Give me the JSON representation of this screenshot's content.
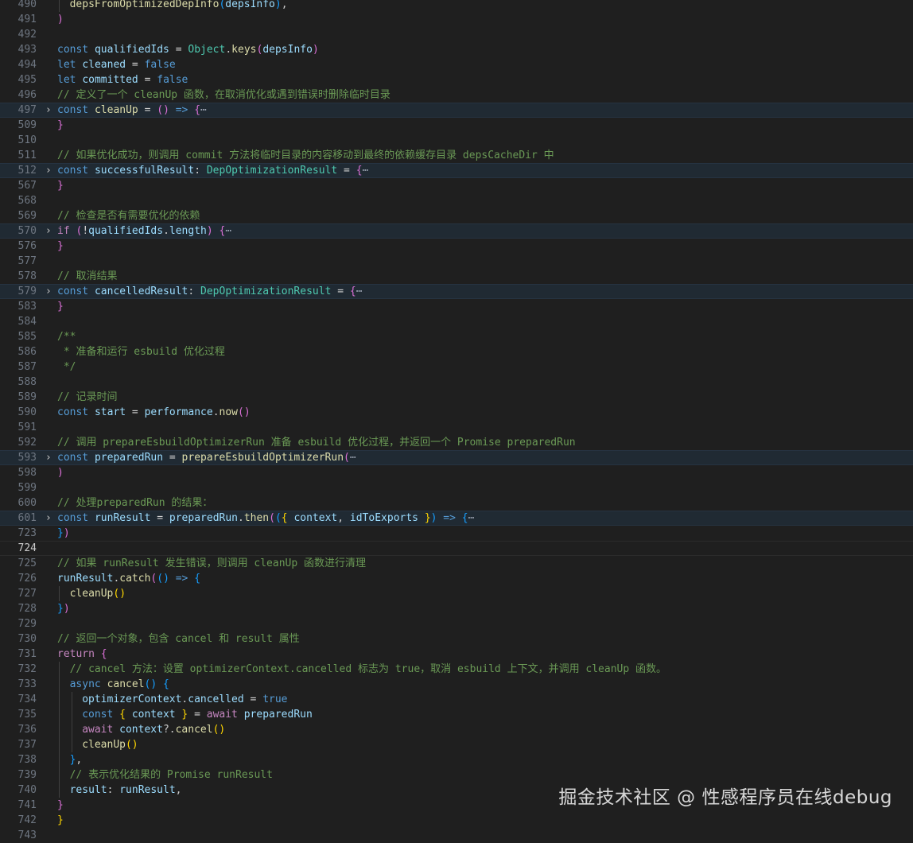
{
  "editor": {
    "lines": [
      {
        "n": "490",
        "indent": 2,
        "tokens": [
          [
            "depsFromOptimizedDepInfo",
            "fn"
          ],
          [
            "(",
            "b3"
          ],
          [
            "depsInfo",
            "var"
          ],
          [
            ")",
            "b3"
          ],
          [
            ",",
            "pun"
          ]
        ]
      },
      {
        "n": "491",
        "indent": 1,
        "tokens": [
          [
            ")",
            "b2"
          ]
        ]
      },
      {
        "n": "492",
        "indent": 0,
        "tokens": []
      },
      {
        "n": "493",
        "indent": 1,
        "tokens": [
          [
            "const ",
            "kw"
          ],
          [
            "qualifiedIds",
            "var"
          ],
          [
            " = ",
            "op"
          ],
          [
            "Object",
            "type"
          ],
          [
            ".",
            "pun"
          ],
          [
            "keys",
            "fn"
          ],
          [
            "(",
            "b2"
          ],
          [
            "depsInfo",
            "var"
          ],
          [
            ")",
            "b2"
          ]
        ]
      },
      {
        "n": "494",
        "indent": 1,
        "tokens": [
          [
            "let ",
            "kw"
          ],
          [
            "cleaned",
            "var"
          ],
          [
            " = ",
            "op"
          ],
          [
            "false",
            "kw"
          ]
        ]
      },
      {
        "n": "495",
        "indent": 1,
        "tokens": [
          [
            "let ",
            "kw"
          ],
          [
            "committed",
            "var"
          ],
          [
            " = ",
            "op"
          ],
          [
            "false",
            "kw"
          ]
        ]
      },
      {
        "n": "496",
        "indent": 1,
        "tokens": [
          [
            "// 定义了一个 cleanUp 函数，在取消优化或遇到错误时删除临时目录",
            "cm"
          ]
        ]
      },
      {
        "n": "497",
        "indent": 1,
        "fold": true,
        "tokens": [
          [
            "const ",
            "kw"
          ],
          [
            "cleanUp",
            "fn"
          ],
          [
            " = ",
            "op"
          ],
          [
            "()",
            "b2"
          ],
          [
            " => ",
            "kw"
          ],
          [
            "{",
            "b2"
          ],
          [
            "⋯",
            "dim"
          ]
        ]
      },
      {
        "n": "509",
        "indent": 1,
        "tokens": [
          [
            "}",
            "b2"
          ]
        ]
      },
      {
        "n": "510",
        "indent": 0,
        "tokens": []
      },
      {
        "n": "511",
        "indent": 1,
        "tokens": [
          [
            "// 如果优化成功，则调用 commit 方法将临时目录的内容移动到最终的依赖缓存目录 depsCacheDir 中",
            "cm"
          ]
        ]
      },
      {
        "n": "512",
        "indent": 1,
        "fold": true,
        "tokens": [
          [
            "const ",
            "kw"
          ],
          [
            "successfulResult",
            "var"
          ],
          [
            ": ",
            "pun"
          ],
          [
            "DepOptimizationResult",
            "type"
          ],
          [
            " = ",
            "op"
          ],
          [
            "{",
            "b2"
          ],
          [
            "⋯",
            "dim"
          ]
        ]
      },
      {
        "n": "567",
        "indent": 1,
        "tokens": [
          [
            "}",
            "b2"
          ]
        ]
      },
      {
        "n": "568",
        "indent": 0,
        "tokens": []
      },
      {
        "n": "569",
        "indent": 1,
        "tokens": [
          [
            "// 检查是否有需要优化的依赖",
            "cm"
          ]
        ]
      },
      {
        "n": "570",
        "indent": 1,
        "fold": true,
        "tokens": [
          [
            "if ",
            "ctl"
          ],
          [
            "(",
            "b2"
          ],
          [
            "!",
            "op"
          ],
          [
            "qualifiedIds",
            "var"
          ],
          [
            ".",
            "pun"
          ],
          [
            "length",
            "var"
          ],
          [
            ")",
            "b2"
          ],
          [
            " ",
            "pun"
          ],
          [
            "{",
            "b2"
          ],
          [
            "⋯",
            "dim"
          ]
        ]
      },
      {
        "n": "576",
        "indent": 1,
        "tokens": [
          [
            "}",
            "b2"
          ]
        ]
      },
      {
        "n": "577",
        "indent": 0,
        "tokens": []
      },
      {
        "n": "578",
        "indent": 1,
        "tokens": [
          [
            "// 取消结果",
            "cm"
          ]
        ]
      },
      {
        "n": "579",
        "indent": 1,
        "fold": true,
        "tokens": [
          [
            "const ",
            "kw"
          ],
          [
            "cancelledResult",
            "var"
          ],
          [
            ": ",
            "pun"
          ],
          [
            "DepOptimizationResult",
            "type"
          ],
          [
            " = ",
            "op"
          ],
          [
            "{",
            "b2"
          ],
          [
            "⋯",
            "dim"
          ]
        ]
      },
      {
        "n": "583",
        "indent": 1,
        "tokens": [
          [
            "}",
            "b2"
          ]
        ]
      },
      {
        "n": "584",
        "indent": 0,
        "tokens": []
      },
      {
        "n": "585",
        "indent": 1,
        "tokens": [
          [
            "/**",
            "cm"
          ]
        ]
      },
      {
        "n": "586",
        "indent": 1,
        "tokens": [
          [
            " * 准备和运行 esbuild 优化过程",
            "cm"
          ]
        ]
      },
      {
        "n": "587",
        "indent": 1,
        "tokens": [
          [
            " */",
            "cm"
          ]
        ]
      },
      {
        "n": "588",
        "indent": 0,
        "tokens": []
      },
      {
        "n": "589",
        "indent": 1,
        "tokens": [
          [
            "// 记录时间",
            "cm"
          ]
        ]
      },
      {
        "n": "590",
        "indent": 1,
        "tokens": [
          [
            "const ",
            "kw"
          ],
          [
            "start",
            "var"
          ],
          [
            " = ",
            "op"
          ],
          [
            "performance",
            "var"
          ],
          [
            ".",
            "pun"
          ],
          [
            "now",
            "fn"
          ],
          [
            "()",
            "b2"
          ]
        ]
      },
      {
        "n": "591",
        "indent": 0,
        "tokens": []
      },
      {
        "n": "592",
        "indent": 1,
        "tokens": [
          [
            "// 调用 prepareEsbuildOptimizerRun 准备 esbuild 优化过程，并返回一个 Promise preparedRun",
            "cm"
          ]
        ]
      },
      {
        "n": "593",
        "indent": 1,
        "fold": true,
        "tokens": [
          [
            "const ",
            "kw"
          ],
          [
            "preparedRun",
            "var"
          ],
          [
            " = ",
            "op"
          ],
          [
            "prepareEsbuildOptimizerRun",
            "fn"
          ],
          [
            "(",
            "b2"
          ],
          [
            "⋯",
            "dim"
          ]
        ]
      },
      {
        "n": "598",
        "indent": 1,
        "tokens": [
          [
            ")",
            "b2"
          ]
        ]
      },
      {
        "n": "599",
        "indent": 0,
        "tokens": []
      },
      {
        "n": "600",
        "indent": 1,
        "tokens": [
          [
            "// 处理preparedRun 的结果：",
            "cm"
          ]
        ]
      },
      {
        "n": "601",
        "indent": 1,
        "fold": true,
        "tokens": [
          [
            "const ",
            "kw"
          ],
          [
            "runResult",
            "var"
          ],
          [
            " = ",
            "op"
          ],
          [
            "preparedRun",
            "var"
          ],
          [
            ".",
            "pun"
          ],
          [
            "then",
            "fn"
          ],
          [
            "(",
            "b2"
          ],
          [
            "(",
            "b3"
          ],
          [
            "{ ",
            "b1"
          ],
          [
            "context",
            "var"
          ],
          [
            ", ",
            "pun"
          ],
          [
            "idToExports",
            "var"
          ],
          [
            " }",
            "b1"
          ],
          [
            ")",
            "b3"
          ],
          [
            " => ",
            "kw"
          ],
          [
            "{",
            "b3"
          ],
          [
            "⋯",
            "dim"
          ]
        ]
      },
      {
        "n": "723",
        "indent": 1,
        "tokens": [
          [
            "}",
            "b3"
          ],
          [
            ")",
            "b2"
          ]
        ]
      },
      {
        "n": "724",
        "indent": 0,
        "current": true,
        "tokens": []
      },
      {
        "n": "725",
        "indent": 1,
        "tokens": [
          [
            "// 如果 runResult 发生错误，则调用 cleanUp 函数进行清理",
            "cm"
          ]
        ]
      },
      {
        "n": "726",
        "indent": 1,
        "tokens": [
          [
            "runResult",
            "var"
          ],
          [
            ".",
            "pun"
          ],
          [
            "catch",
            "fn"
          ],
          [
            "(",
            "b2"
          ],
          [
            "()",
            "b3"
          ],
          [
            " => ",
            "kw"
          ],
          [
            "{",
            "b3"
          ]
        ]
      },
      {
        "n": "727",
        "indent": 2,
        "tokens": [
          [
            "cleanUp",
            "fn"
          ],
          [
            "()",
            "b1"
          ]
        ]
      },
      {
        "n": "728",
        "indent": 1,
        "tokens": [
          [
            "}",
            "b3"
          ],
          [
            ")",
            "b2"
          ]
        ]
      },
      {
        "n": "729",
        "indent": 0,
        "tokens": []
      },
      {
        "n": "730",
        "indent": 1,
        "tokens": [
          [
            "// 返回一个对象，包含 cancel 和 result 属性",
            "cm"
          ]
        ]
      },
      {
        "n": "731",
        "indent": 1,
        "tokens": [
          [
            "return ",
            "ctl"
          ],
          [
            "{",
            "b2"
          ]
        ]
      },
      {
        "n": "732",
        "indent": 2,
        "tokens": [
          [
            "// cancel 方法：设置 optimizerContext.cancelled 标志为 true，取消 esbuild 上下文，并调用 cleanUp 函数。",
            "cm"
          ]
        ]
      },
      {
        "n": "733",
        "indent": 2,
        "tokens": [
          [
            "async ",
            "kw"
          ],
          [
            "cancel",
            "fn"
          ],
          [
            "()",
            "b3"
          ],
          [
            " ",
            "pun"
          ],
          [
            "{",
            "b3"
          ]
        ]
      },
      {
        "n": "734",
        "indent": 3,
        "tokens": [
          [
            "optimizerContext",
            "var"
          ],
          [
            ".",
            "pun"
          ],
          [
            "cancelled",
            "var"
          ],
          [
            " = ",
            "op"
          ],
          [
            "true",
            "kw"
          ]
        ]
      },
      {
        "n": "735",
        "indent": 3,
        "tokens": [
          [
            "const ",
            "kw"
          ],
          [
            "{ ",
            "b1"
          ],
          [
            "context",
            "var"
          ],
          [
            " }",
            "b1"
          ],
          [
            " = ",
            "op"
          ],
          [
            "await ",
            "ctl"
          ],
          [
            "preparedRun",
            "var"
          ]
        ]
      },
      {
        "n": "736",
        "indent": 3,
        "tokens": [
          [
            "await ",
            "ctl"
          ],
          [
            "context",
            "var"
          ],
          [
            "?.",
            "pun"
          ],
          [
            "cancel",
            "fn"
          ],
          [
            "()",
            "b1"
          ]
        ]
      },
      {
        "n": "737",
        "indent": 3,
        "tokens": [
          [
            "cleanUp",
            "fn"
          ],
          [
            "()",
            "b1"
          ]
        ]
      },
      {
        "n": "738",
        "indent": 2,
        "tokens": [
          [
            "}",
            "b3"
          ],
          [
            ",",
            "pun"
          ]
        ]
      },
      {
        "n": "739",
        "indent": 2,
        "tokens": [
          [
            "// 表示优化结果的 Promise runResult",
            "cm"
          ]
        ]
      },
      {
        "n": "740",
        "indent": 2,
        "tokens": [
          [
            "result",
            "var"
          ],
          [
            ": ",
            "pun"
          ],
          [
            "runResult",
            "var"
          ],
          [
            ",",
            "pun"
          ]
        ]
      },
      {
        "n": "741",
        "indent": 1,
        "tokens": [
          [
            "}",
            "b2"
          ]
        ]
      },
      {
        "n": "742",
        "indent": 0,
        "tokens": [
          [
            "}",
            "b1"
          ]
        ]
      },
      {
        "n": "743",
        "indent": 0,
        "tokens": []
      }
    ]
  },
  "watermark": "掘金技术社区 @ 性感程序员在线debug"
}
